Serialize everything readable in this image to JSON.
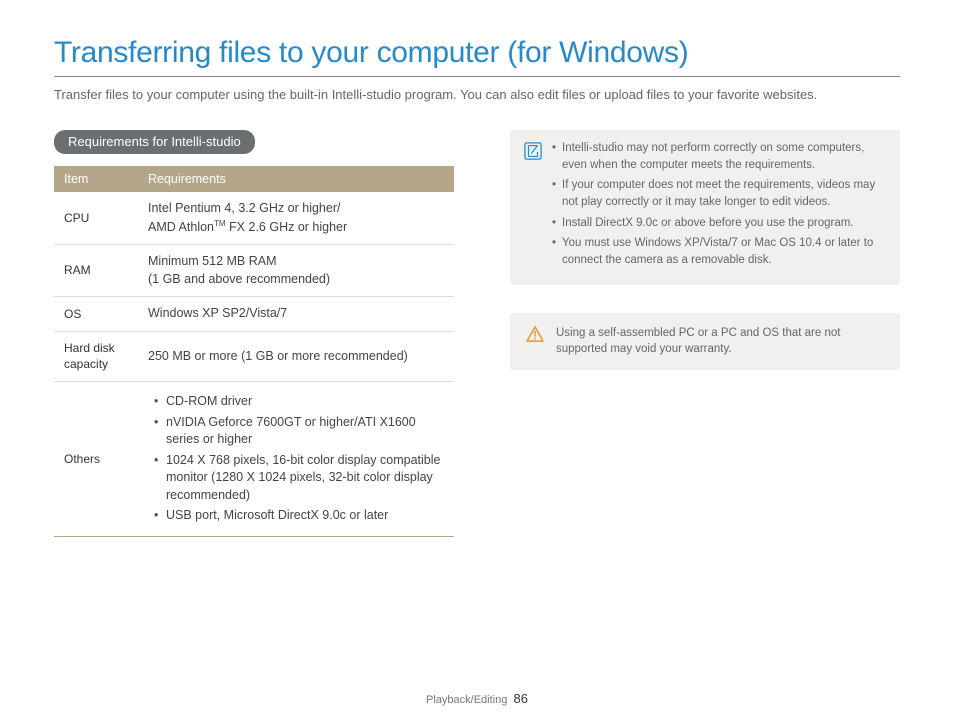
{
  "title": "Transferring files to your computer (for Windows)",
  "intro": "Transfer files to your computer using the built-in Intelli-studio program. You can also edit files or upload files to your favorite websites.",
  "section_heading": "Requirements for Intelli-studio",
  "table": {
    "head_item": "Item",
    "head_req": "Requirements",
    "rows": {
      "cpu": {
        "label": "CPU",
        "l1": "Intel Pentium 4, 3.2 GHz or higher/",
        "l2a": "AMD Athlon",
        "l2_sup": "TM",
        "l2b": " FX 2.6 GHz or higher"
      },
      "ram": {
        "label": "RAM",
        "l1": "Minimum 512 MB RAM",
        "l2": "(1 GB and above recommended)"
      },
      "os": {
        "label": "OS",
        "value": "Windows XP SP2/Vista/7"
      },
      "hdd": {
        "label": "Hard disk capacity",
        "value": "250 MB or more (1 GB or more recommended)"
      },
      "others": {
        "label": "Others",
        "i1": "CD-ROM driver",
        "i2": "nVIDIA Geforce 7600GT or higher/ATI X1600 series or higher",
        "i3": "1024 X 768 pixels, 16-bit color display compatible monitor (1280 X 1024 pixels, 32-bit color display recommended)",
        "i4": "USB port, Microsoft DirectX 9.0c or later"
      }
    }
  },
  "notes": {
    "n1": "Intelli-studio may not perform correctly on some computers, even when the computer meets the requirements.",
    "n2": "If your computer does not meet the requirements, videos may not play correctly or it may take longer to edit videos.",
    "n3": "Install DirectX 9.0c or above before you use the program.",
    "n4": "You must use Windows XP/Vista/7 or Mac OS 10.4 or later to connect the camera as a removable disk."
  },
  "warning": "Using a self-assembled PC or a PC and OS that are not supported may void your warranty.",
  "footer_section": "Playback/Editing",
  "page_number": "86"
}
